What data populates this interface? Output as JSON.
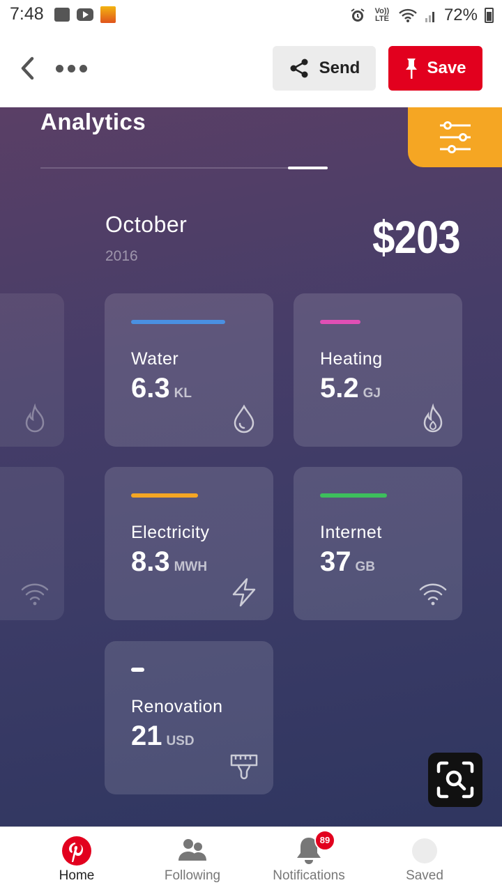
{
  "status_bar": {
    "time": "7:48",
    "network": "Vo)) LTE",
    "battery": "72%"
  },
  "toolbar": {
    "back_icon": "chevron-left-icon",
    "more_icon": "more-dots-icon",
    "send_label": "Send",
    "save_label": "Save"
  },
  "pin": {
    "title": "Analytics",
    "month": "October",
    "year": "2016",
    "total": "$203",
    "cards": [
      {
        "label": "Water",
        "value": "6.3",
        "unit": "KL",
        "color": "#4a90e2",
        "icon": "water-drop-icon"
      },
      {
        "label": "Heating",
        "value": "5.2",
        "unit": "GJ",
        "color": "#e04fb5",
        "icon": "flame-icon"
      },
      {
        "label": "Electricity",
        "value": "8.3",
        "unit": "MWH",
        "color": "#f5a623",
        "icon": "lightning-icon"
      },
      {
        "label": "Internet",
        "value": "37",
        "unit": "GB",
        "color": "#3dbf5c",
        "icon": "wifi-icon"
      },
      {
        "label": "Renovation",
        "value": "21",
        "unit": "USD",
        "color": "#ffffff",
        "icon": "paint-brush-icon"
      }
    ]
  },
  "bottom_nav": {
    "items": [
      {
        "label": "Home"
      },
      {
        "label": "Following"
      },
      {
        "label": "Notifications",
        "badge": "89"
      },
      {
        "label": "Saved"
      }
    ]
  },
  "colors": {
    "brand_red": "#e2001e",
    "accent_orange": "#f5a623"
  }
}
